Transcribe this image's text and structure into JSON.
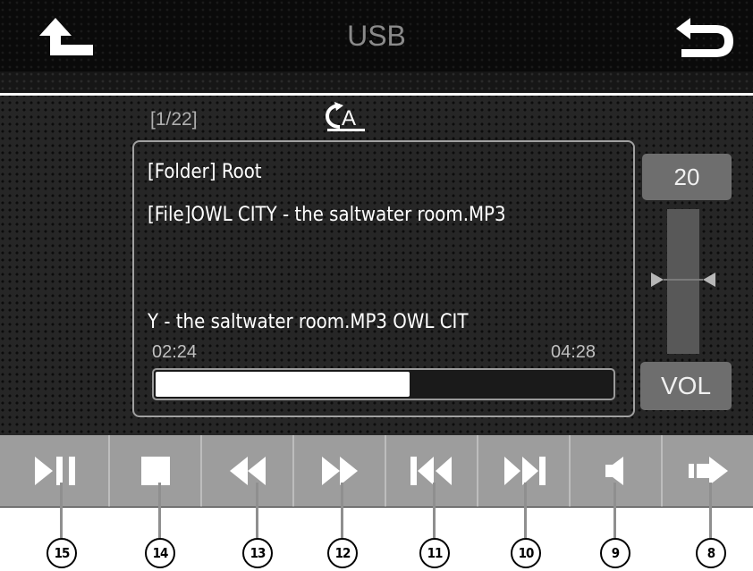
{
  "header": {
    "title": "USB",
    "left_icon": "up-arrow-icon",
    "right_icon": "return-icon"
  },
  "status": {
    "track_counter": "[1/22]",
    "repeat_icon": "repeat-all-icon",
    "repeat_letter": "A"
  },
  "info": {
    "folder": "[Folder] Root",
    "file": "[File]OWL CITY - the saltwater room.MP3",
    "scroll_text": "Y - the saltwater room.MP3  OWL CIT",
    "elapsed": "02:24",
    "total": "04:28",
    "progress": 0.56
  },
  "volume": {
    "level": "20",
    "button_label": "VOL"
  },
  "toolbar": {
    "buttons": [
      {
        "icon": "play-pause-icon",
        "callout": "15"
      },
      {
        "icon": "stop-icon",
        "callout": "14"
      },
      {
        "icon": "rewind-icon",
        "callout": "13"
      },
      {
        "icon": "fast-forward-icon",
        "callout": "12"
      },
      {
        "icon": "previous-track-icon",
        "callout": "11"
      },
      {
        "icon": "next-track-icon",
        "callout": "10"
      },
      {
        "icon": "mute-icon",
        "callout": "9"
      },
      {
        "icon": "next-page-icon",
        "callout": "8"
      }
    ]
  },
  "colors": {
    "background": "#262626",
    "header": "#0a0a0a",
    "toolbar": "#9d9d9d",
    "progress_fill": "#ffffff",
    "volume_box": "#6e6e6e"
  }
}
